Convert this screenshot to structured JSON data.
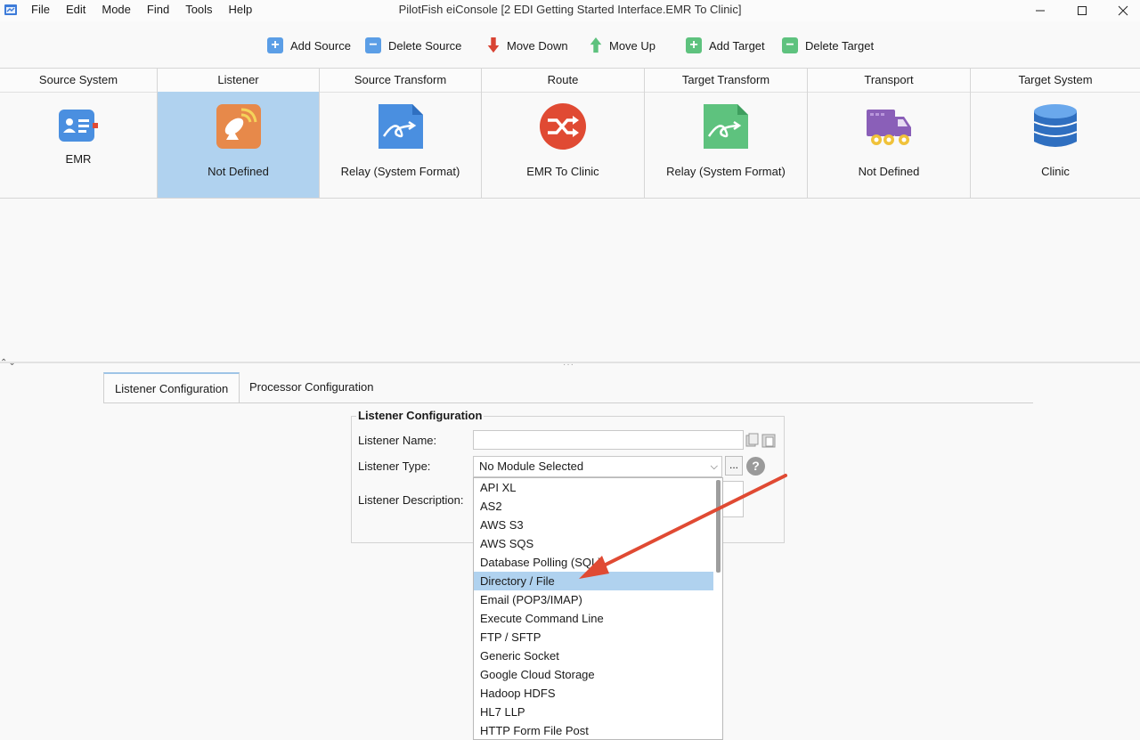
{
  "window": {
    "title": "PilotFish eiConsole [2 EDI Getting Started Interface.EMR To Clinic]"
  },
  "menu": [
    "File",
    "Edit",
    "Mode",
    "Find",
    "Tools",
    "Help"
  ],
  "toolbar": {
    "add_source": "Add Source",
    "delete_source": "Delete Source",
    "move_down": "Move Down",
    "move_up": "Move Up",
    "add_target": "Add Target",
    "delete_target": "Delete Target"
  },
  "stages": [
    {
      "header": "Source System",
      "label": "EMR",
      "icon": "id-card-icon",
      "selected": false
    },
    {
      "header": "Listener",
      "label": "Not Defined",
      "icon": "satellite-dish-icon",
      "selected": true
    },
    {
      "header": "Source Transform",
      "label": "Relay (System Format)",
      "icon": "relay-document-icon",
      "selected": false
    },
    {
      "header": "Route",
      "label": "EMR To Clinic",
      "icon": "route-shuffle-icon",
      "selected": false
    },
    {
      "header": "Target Transform",
      "label": "Relay (System Format)",
      "icon": "relay-document-icon",
      "selected": false
    },
    {
      "header": "Transport",
      "label": "Not Defined",
      "icon": "truck-icon",
      "selected": false
    },
    {
      "header": "Target System",
      "label": "Clinic",
      "icon": "database-icon",
      "selected": false
    }
  ],
  "tabs": {
    "listener": "Listener Configuration",
    "processor": "Processor Configuration"
  },
  "form": {
    "group_title": "Listener Configuration",
    "name_label": "Listener Name:",
    "name_value": "",
    "type_label": "Listener Type:",
    "type_value": "No Module Selected",
    "description_label": "Listener Description:",
    "dots_label": "..."
  },
  "dropdown": {
    "selected_index": 5,
    "items": [
      "API XL",
      "AS2",
      "AWS S3",
      "AWS SQS",
      "Database Polling (SQL)",
      "Directory / File",
      "Email (POP3/IMAP)",
      "Execute Command Line",
      "FTP / SFTP",
      "Generic Socket",
      "Google Cloud Storage",
      "Hadoop HDFS",
      "HL7 LLP",
      "HTTP Form File Post"
    ]
  },
  "colors": {
    "selection": "#b0d2ef",
    "annotation_arrow": "#e04a33"
  }
}
